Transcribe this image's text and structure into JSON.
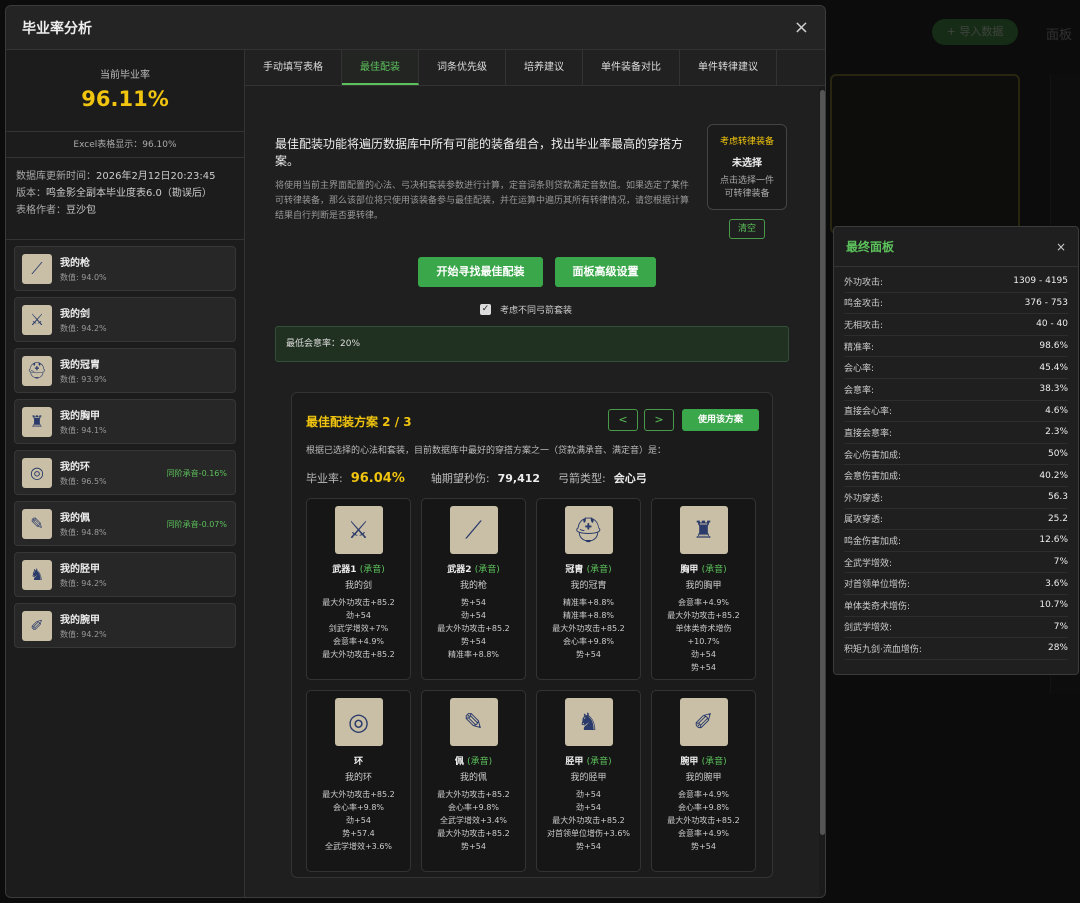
{
  "background": {
    "top_button": "+ 导入数据",
    "top_tab": "面板"
  },
  "modal": {
    "title": "毕业率分析",
    "close": "×"
  },
  "left": {
    "rate_label": "当前毕业率",
    "rate_value": "96.11%",
    "excel": "Excel表格显示：96.10%",
    "meta": [
      {
        "k": "数据库更新时间：",
        "v": "2026年2月12日20:23:45"
      },
      {
        "k": "版本：",
        "v": "鸣金影全副本毕业度表6.0（勘误后）"
      },
      {
        "k": "表格作者：",
        "v": "豆沙包"
      }
    ],
    "equipment": [
      {
        "name": "我的枪",
        "score": "数值: 94.0%",
        "tag": "",
        "icon": "spear-icon",
        "glyph": "⟋"
      },
      {
        "name": "我的剑",
        "score": "数值: 94.2%",
        "tag": "",
        "icon": "sword-icon",
        "glyph": "⚔"
      },
      {
        "name": "我的冠胄",
        "score": "数值: 93.9%",
        "tag": "",
        "icon": "helmet-icon",
        "glyph": "⛑"
      },
      {
        "name": "我的胸甲",
        "score": "数值: 94.1%",
        "tag": "",
        "icon": "chest-armor-icon",
        "glyph": "♜"
      },
      {
        "name": "我的环",
        "score": "数值: 96.5%",
        "tag": "同阶承音-0.16%",
        "icon": "ring-icon",
        "glyph": "◎"
      },
      {
        "name": "我的佩",
        "score": "数值: 94.8%",
        "tag": "同阶承音-0.07%",
        "icon": "pendant-icon",
        "glyph": "✎"
      },
      {
        "name": "我的胫甲",
        "score": "数值: 94.2%",
        "tag": "",
        "icon": "greaves-icon",
        "glyph": "♞"
      },
      {
        "name": "我的腕甲",
        "score": "数值: 94.2%",
        "tag": "",
        "icon": "bracer-icon",
        "glyph": "✐"
      }
    ]
  },
  "tabs": [
    "手动填写表格",
    "最佳配装",
    "词条优先级",
    "培养建议",
    "单件装备对比",
    "单件转律建议"
  ],
  "active_tab": 1,
  "content": {
    "intro": "最佳配装功能将遍历数据库中所有可能的装备组合，找出毕业率最高的穿搭方案。",
    "intro2": "将使用当前主界面配置的心法、弓决和套装参数进行计算，定音词条则贷款满定音数值。如果选定了某件可转律装备，那么该部位将只使用该装备参与最佳配装，并在运算中遍历其所有转律情况，请您根据计算结果自行判断是否要转律。",
    "cross": {
      "title": "考虑转律装备",
      "state": "未选择",
      "desc1": "点击选择一件",
      "desc2": "可转律装备"
    },
    "clear": "清空",
    "find_btn": "开始寻找最佳配装",
    "adv_btn": "面板高级设置",
    "checkbox": "考虑不同弓箭套装",
    "crit": "最低会意率：20%",
    "plan": {
      "title": "最佳配装方案 2 / 3",
      "prev": "<",
      "next": ">",
      "use": "使用该方案",
      "desc": "根据已选择的心法和套装，目前数据库中最好的穿搭方案之一（贷款满承音、满定音）是：",
      "rate_label": "毕业率:",
      "rate": "96.04%",
      "dps_label": "轴期望秒伤:",
      "dps": "79,412",
      "bow_label": "弓箭类型:",
      "bow": "会心弓",
      "cards": [
        {
          "slot": "武器1",
          "tag": "(承音)",
          "own": "我的剑",
          "icon": "sword-icon",
          "glyph": "⚔",
          "stats": [
            "最大外功攻击+85.2",
            "劲+54",
            "剑武学增效+7%",
            "会意率+4.9%",
            "最大外功攻击+85.2"
          ]
        },
        {
          "slot": "武器2",
          "tag": "(承音)",
          "own": "我的枪",
          "icon": "spear-icon",
          "glyph": "⟋",
          "stats": [
            "势+54",
            "劲+54",
            "最大外功攻击+85.2",
            "势+54",
            "精准率+8.8%"
          ]
        },
        {
          "slot": "冠胄",
          "tag": "(承音)",
          "own": "我的冠胄",
          "icon": "helmet-icon",
          "glyph": "⛑",
          "stats": [
            "精准率+8.8%",
            "精准率+8.8%",
            "最大外功攻击+85.2",
            "会心率+9.8%",
            "势+54"
          ]
        },
        {
          "slot": "胸甲",
          "tag": "(承音)",
          "own": "我的胸甲",
          "icon": "chest-armor-icon",
          "glyph": "♜",
          "stats": [
            "会意率+4.9%",
            "最大外功攻击+85.2",
            "单体类奇术增伤",
            "+10.7%",
            "劲+54",
            "势+54"
          ]
        },
        {
          "slot": "环",
          "tag": "",
          "own": "我的环",
          "icon": "ring-icon",
          "glyph": "◎",
          "stats": [
            "最大外功攻击+85.2",
            "会心率+9.8%",
            "劲+54",
            "势+57.4",
            "全武学增效+3.6%"
          ]
        },
        {
          "slot": "佩",
          "tag": "(承音)",
          "own": "我的佩",
          "icon": "pendant-icon",
          "glyph": "✎",
          "stats": [
            "最大外功攻击+85.2",
            "会心率+9.8%",
            "全武学增效+3.4%",
            "最大外功攻击+85.2",
            "势+54"
          ]
        },
        {
          "slot": "胫甲",
          "tag": "(承音)",
          "own": "我的胫甲",
          "icon": "greaves-icon",
          "glyph": "♞",
          "stats": [
            "劲+54",
            "劲+54",
            "最大外功攻击+85.2",
            "对首领单位增伤+3.6%",
            "势+54"
          ]
        },
        {
          "slot": "腕甲",
          "tag": "(承音)",
          "own": "我的腕甲",
          "icon": "bracer-icon",
          "glyph": "✐",
          "stats": [
            "会意率+4.9%",
            "会心率+9.8%",
            "最大外功攻击+85.2",
            "会意率+4.9%",
            "势+54"
          ]
        }
      ]
    }
  },
  "panel": {
    "title": "最终面板",
    "close": "×",
    "rows": [
      {
        "k": "外功攻击:",
        "v": "1309 - 4195"
      },
      {
        "k": "鸣金攻击:",
        "v": "376 - 753"
      },
      {
        "k": "无相攻击:",
        "v": "40 - 40"
      },
      {
        "k": "精准率:",
        "v": "98.6%"
      },
      {
        "k": "会心率:",
        "v": "45.4%"
      },
      {
        "k": "会意率:",
        "v": "38.3%"
      },
      {
        "k": "直接会心率:",
        "v": "4.6%"
      },
      {
        "k": "直接会意率:",
        "v": "2.3%"
      },
      {
        "k": "会心伤害加成:",
        "v": "50%"
      },
      {
        "k": "会意伤害加成:",
        "v": "40.2%"
      },
      {
        "k": "外功穿透:",
        "v": "56.3"
      },
      {
        "k": "属攻穿透:",
        "v": "25.2"
      },
      {
        "k": "鸣金伤害加成:",
        "v": "12.6%"
      },
      {
        "k": "全武学增效:",
        "v": "7%"
      },
      {
        "k": "对首领单位增伤:",
        "v": "3.6%"
      },
      {
        "k": "单体类奇术增伤:",
        "v": "10.7%"
      },
      {
        "k": "剑武学增效:",
        "v": "7%"
      },
      {
        "k": "积矩九剑·流血增伤:",
        "v": "28%"
      }
    ]
  }
}
